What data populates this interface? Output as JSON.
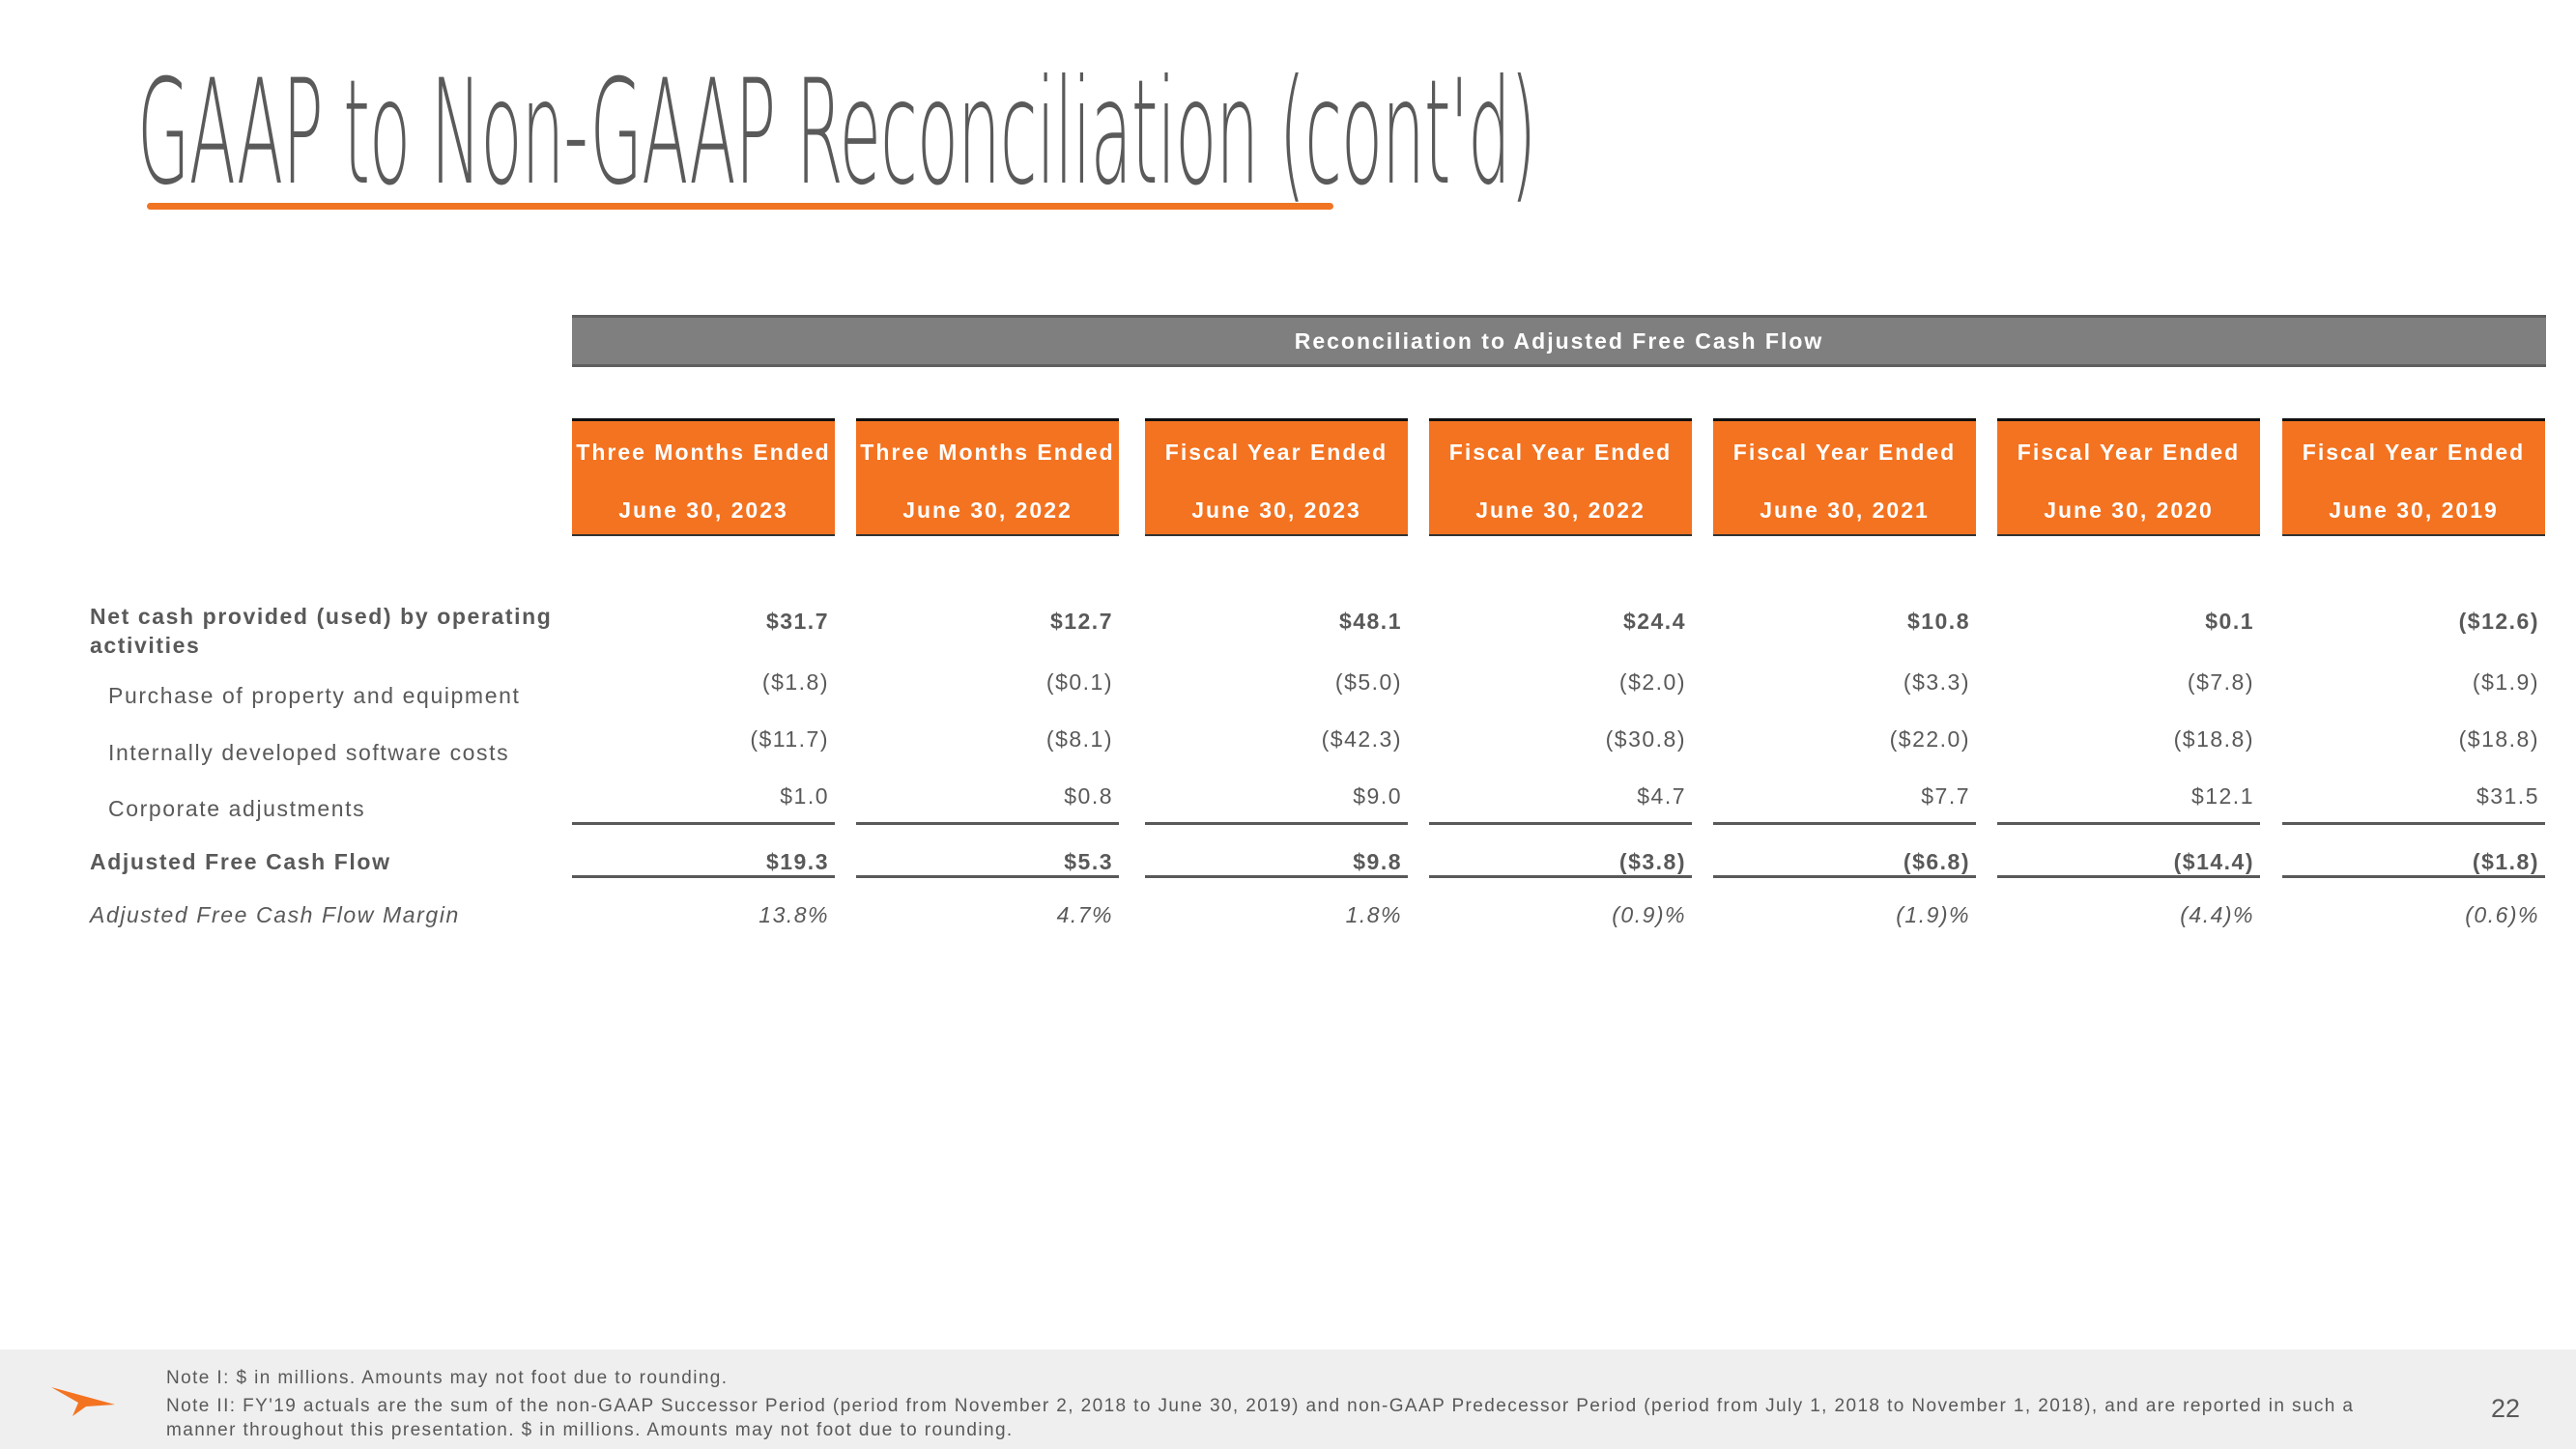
{
  "title": "GAAP to Non-GAAP Reconciliation (cont'd)",
  "colors": {
    "accent_orange": "#F37321",
    "section_bar_gray": "#7F7F7F",
    "text_gray": "#595959",
    "footer_bg": "#EFEFEF"
  },
  "table": {
    "section_title": "Reconciliation to Adjusted Free Cash Flow",
    "columns": [
      {
        "line1": "Three Months Ended",
        "line2": "June 30, 2023"
      },
      {
        "line1": "Three Months Ended",
        "line2": "June 30, 2022"
      },
      {
        "line1": "Fiscal Year Ended",
        "line2": "June 30, 2023"
      },
      {
        "line1": "Fiscal Year Ended",
        "line2": "June 30, 2022"
      },
      {
        "line1": "Fiscal Year Ended",
        "line2": "June 30, 2021"
      },
      {
        "line1": "Fiscal Year Ended",
        "line2": "June 30, 2020"
      },
      {
        "line1": "Fiscal Year Ended",
        "line2": "June 30, 2019"
      }
    ],
    "rows": [
      {
        "label": "Net cash provided (used) by operating",
        "label_line2": "activities",
        "style": "bold",
        "values": [
          "$31.7",
          "$12.7",
          "$48.1",
          "$24.4",
          "$10.8",
          "$0.1",
          "($12.6)"
        ]
      },
      {
        "label": "Purchase of property and equipment",
        "style": "indent",
        "values": [
          "($1.8)",
          "($0.1)",
          "($5.0)",
          "($2.0)",
          "($3.3)",
          "($7.8)",
          "($1.9)"
        ]
      },
      {
        "label": "Internally developed software costs",
        "style": "indent",
        "values": [
          "($11.7)",
          "($8.1)",
          "($42.3)",
          "($30.8)",
          "($22.0)",
          "($18.8)",
          "($18.8)"
        ]
      },
      {
        "label": "Corporate adjustments",
        "style": "indent",
        "values": [
          "$1.0",
          "$0.8",
          "$9.0",
          "$4.7",
          "$7.7",
          "$12.1",
          "$31.5"
        ]
      },
      {
        "label": "Adjusted Free Cash Flow",
        "style": "bold",
        "values": [
          "$19.3",
          "$5.3",
          "$9.8",
          "($3.8)",
          "($6.8)",
          "($14.4)",
          "($1.8)"
        ]
      },
      {
        "label": "Adjusted Free Cash Flow Margin",
        "style": "italic",
        "values": [
          "13.8%",
          "4.7%",
          "1.8%",
          "(0.9)%",
          "(1.9)%",
          "(4.4)%",
          "(0.6)%"
        ]
      }
    ]
  },
  "footer": {
    "logo_icon": "orange-arrow-logo",
    "note1": "Note I: $ in millions. Amounts may not foot due to rounding.",
    "note2": "Note II: FY'19 actuals are the sum of the non-GAAP Successor Period (period from November 2, 2018 to June 30, 2019) and non-GAAP Predecessor Period (period from July 1, 2018 to November 1, 2018), and are reported in such a",
    "note3": "manner throughout this presentation. $ in millions. Amounts may not foot due to rounding.",
    "page_number": "22"
  }
}
